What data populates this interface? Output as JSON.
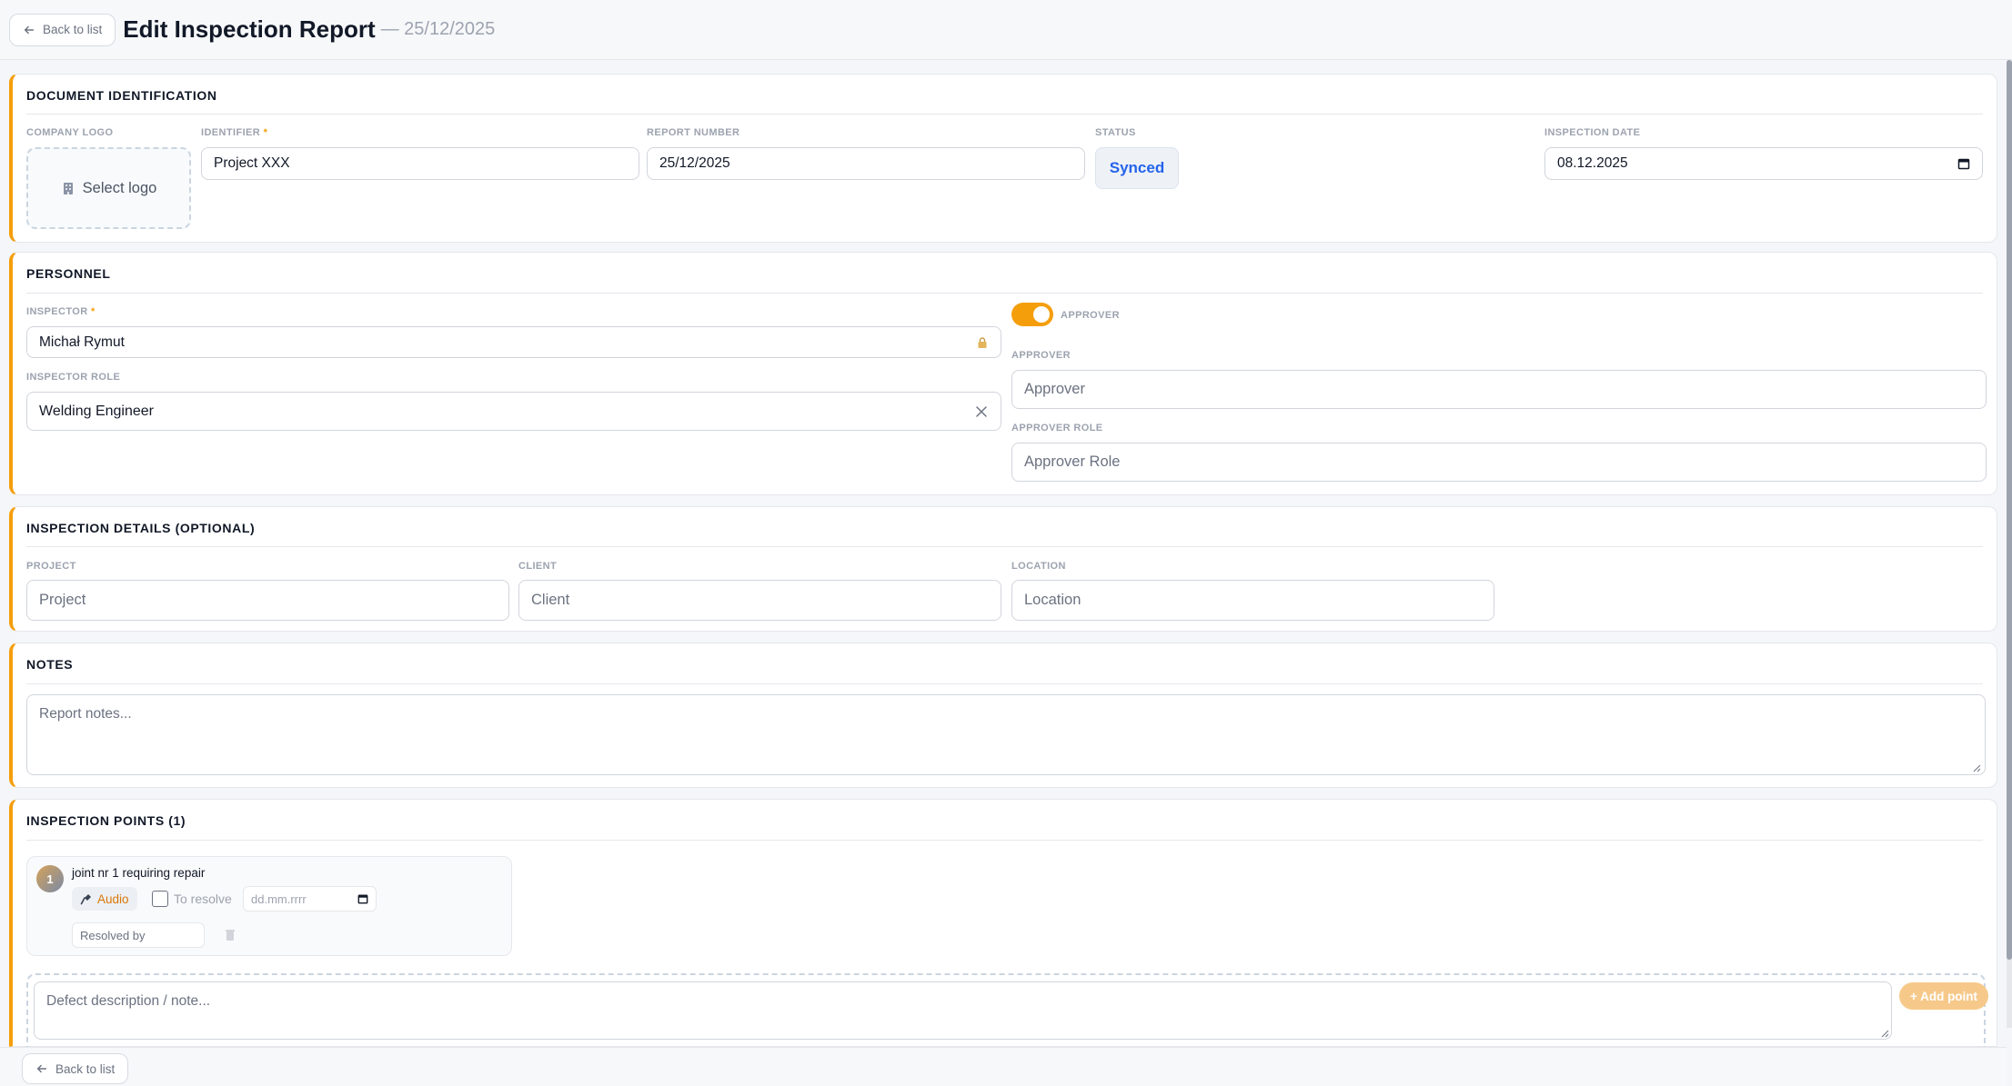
{
  "header": {
    "back_label": "Back to list",
    "title": "Edit Inspection Report",
    "date_suffix": "— 25/12/2025"
  },
  "doc_id": {
    "title": "DOCUMENT IDENTIFICATION",
    "logo_label": "COMPANY LOGO",
    "logo_button": "Select logo",
    "identifier_label": "IDENTIFIER",
    "identifier_value": "Project XXX",
    "report_number_label": "REPORT NUMBER",
    "report_number_value": "25/12/2025",
    "status_label": "STATUS",
    "status_value": "Synced",
    "inspection_date_label": "INSPECTION DATE",
    "inspection_date_value": "08.12.2025",
    "required_mark": "*"
  },
  "personnel": {
    "title": "PERSONNEL",
    "inspector_label": "INSPECTOR",
    "inspector_value": "Michał Rymut",
    "inspector_role_label": "INSPECTOR ROLE",
    "inspector_role_value": "Welding Engineer",
    "approver_toggle_label": "APPROVER",
    "approver_toggle_on": true,
    "approver_label": "APPROVER",
    "approver_placeholder": "Approver",
    "approver_role_label": "APPROVER ROLE",
    "approver_role_placeholder": "Approver Role"
  },
  "details": {
    "title": "INSPECTION DETAILS (OPTIONAL)",
    "project_label": "PROJECT",
    "project_placeholder": "Project",
    "client_label": "CLIENT",
    "client_placeholder": "Client",
    "location_label": "LOCATION",
    "location_placeholder": "Location"
  },
  "notes": {
    "title": "NOTES",
    "placeholder": "Report notes..."
  },
  "points": {
    "title": "INSPECTION POINTS (1)",
    "items": [
      {
        "number": "1",
        "description": "joint nr 1 requiring repair",
        "audio_label": "Audio",
        "to_resolve_label": "To resolve",
        "to_resolve_checked": false,
        "date_placeholder": "dd.mm.rrrr",
        "resolved_by_placeholder": "Resolved by"
      }
    ],
    "defect_placeholder": "Defect description / note...",
    "add_point_label": "+ Add point"
  },
  "footer": {
    "back_label": "Back to list"
  },
  "colors": {
    "accent": "#f59e0b",
    "status_text": "#2563eb"
  }
}
